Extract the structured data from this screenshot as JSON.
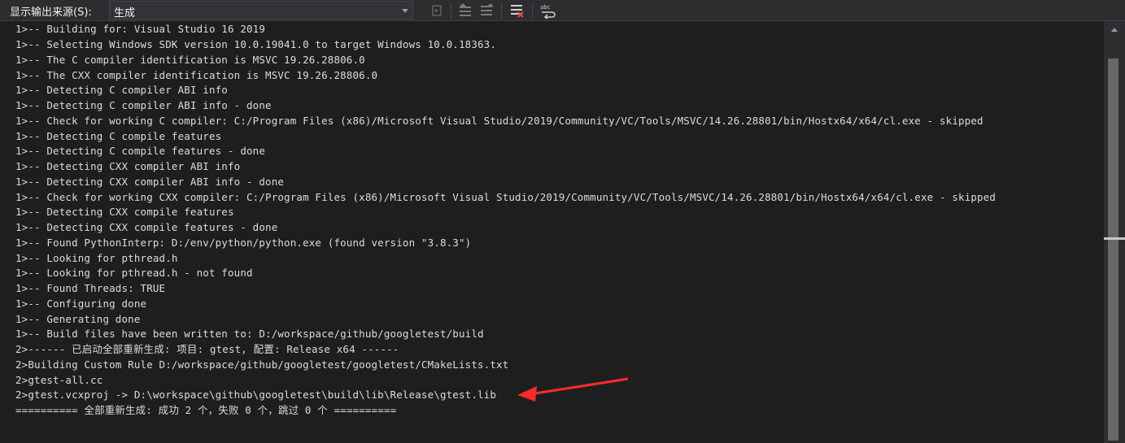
{
  "toolbar": {
    "label": "显示输出来源(S):",
    "source_value": "生成",
    "buttons": [
      {
        "name": "go-to-error-button",
        "icon": "goto-line-icon"
      },
      {
        "name": "previous-message-button",
        "icon": "previous-message-icon"
      },
      {
        "name": "next-message-button",
        "icon": "next-message-icon"
      },
      {
        "name": "clear-all-button",
        "icon": "clear-all-icon"
      },
      {
        "name": "word-wrap-button",
        "icon": "word-wrap-icon"
      }
    ]
  },
  "output": {
    "lines": [
      "1>-- Building for: Visual Studio 16 2019",
      "1>-- Selecting Windows SDK version 10.0.19041.0 to target Windows 10.0.18363.",
      "1>-- The C compiler identification is MSVC 19.26.28806.0",
      "1>-- The CXX compiler identification is MSVC 19.26.28806.0",
      "1>-- Detecting C compiler ABI info",
      "1>-- Detecting C compiler ABI info - done",
      "1>-- Check for working C compiler: C:/Program Files (x86)/Microsoft Visual Studio/2019/Community/VC/Tools/MSVC/14.26.28801/bin/Hostx64/x64/cl.exe - skipped",
      "1>-- Detecting C compile features",
      "1>-- Detecting C compile features - done",
      "1>-- Detecting CXX compiler ABI info",
      "1>-- Detecting CXX compiler ABI info - done",
      "1>-- Check for working CXX compiler: C:/Program Files (x86)/Microsoft Visual Studio/2019/Community/VC/Tools/MSVC/14.26.28801/bin/Hostx64/x64/cl.exe - skipped",
      "1>-- Detecting CXX compile features",
      "1>-- Detecting CXX compile features - done",
      "1>-- Found PythonInterp: D:/env/python/python.exe (found version \"3.8.3\")",
      "1>-- Looking for pthread.h",
      "1>-- Looking for pthread.h - not found",
      "1>-- Found Threads: TRUE",
      "1>-- Configuring done",
      "1>-- Generating done",
      "1>-- Build files have been written to: D:/workspace/github/googletest/build",
      "2>------ 已启动全部重新生成: 项目: gtest, 配置: Release x64 ------",
      "2>Building Custom Rule D:/workspace/github/googletest/googletest/CMakeLists.txt",
      "2>gtest-all.cc",
      "2>gtest.vcxproj -> D:\\workspace\\github\\googletest\\build\\lib\\Release\\gtest.lib",
      "========== 全部重新生成: 成功 2 个，失败 0 个，跳过 0 个 =========="
    ]
  },
  "annotation": {
    "color": "#ff2a2a",
    "icon": "red-arrow-icon"
  }
}
